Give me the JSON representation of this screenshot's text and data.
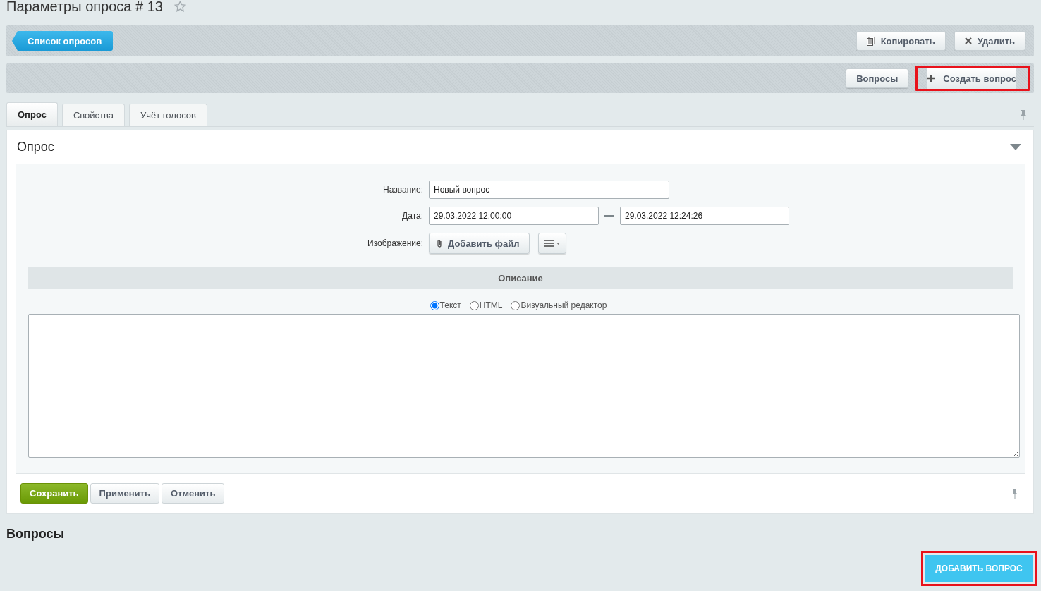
{
  "page": {
    "title": "Параметры опроса # 13",
    "favorite": false
  },
  "toolbar_top": {
    "back_button": "Список опросов",
    "buttons": [
      {
        "label": "Копировать",
        "kind": "copy",
        "highlighted": false
      },
      {
        "label": "Удалить",
        "kind": "delete",
        "highlighted": false
      }
    ]
  },
  "toolbar_second": {
    "buttons": [
      {
        "label": "Вопросы",
        "kind": "plain",
        "highlighted": false
      },
      {
        "label": "Создать вопрос",
        "kind": "add",
        "highlighted": true
      }
    ]
  },
  "tabs": [
    {
      "label": "Опрос",
      "selected": true
    },
    {
      "label": "Свойства",
      "selected": false
    },
    {
      "label": "Учёт голосов",
      "selected": false
    }
  ],
  "section": {
    "title": "Опрос",
    "expanded": true,
    "fields": [
      {
        "kind": "text",
        "label": "Название:",
        "value": "Новый вопрос"
      },
      {
        "kind": "daterange",
        "label": "Дата:",
        "from": "29.03.2022 12:00:00",
        "to": "29.03.2022 12:24:26"
      },
      {
        "kind": "file",
        "label": "Изображение:",
        "button": "Добавить файл"
      }
    ],
    "description": {
      "title": "Описание",
      "modes": [
        {
          "label": "Текст",
          "selected": true
        },
        {
          "label": "HTML",
          "selected": false
        },
        {
          "label": "Визуальный редактор",
          "selected": false
        }
      ]
    }
  },
  "actions": [
    {
      "label": "Сохранить",
      "kind": "primary"
    },
    {
      "label": "Применить",
      "kind": "plain"
    },
    {
      "label": "Отменить",
      "kind": "plain"
    }
  ],
  "questions": {
    "title": "Вопросы",
    "add_button": {
      "label": "ДОБАВИТЬ ВОПРОС",
      "highlighted": true
    }
  }
}
